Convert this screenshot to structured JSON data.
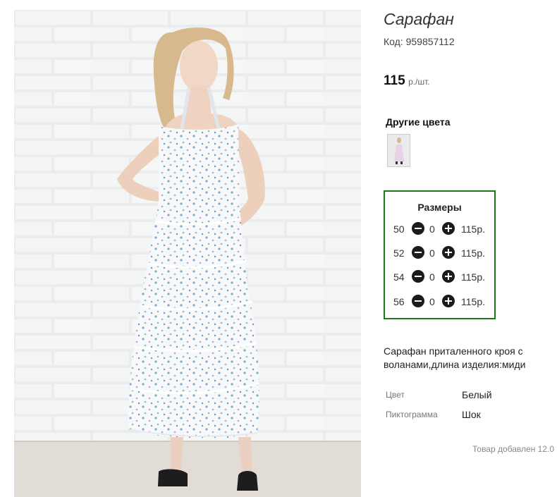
{
  "product": {
    "title": "Сарафан",
    "code_label": "Код:",
    "code": "959857112",
    "price": "115",
    "price_unit": "р./шт."
  },
  "other_colors": {
    "heading": "Другие цвета"
  },
  "sizes": {
    "heading": "Размеры",
    "rows": [
      {
        "size": "50",
        "qty": "0",
        "price": "115р."
      },
      {
        "size": "52",
        "qty": "0",
        "price": "115р."
      },
      {
        "size": "54",
        "qty": "0",
        "price": "115р."
      },
      {
        "size": "56",
        "qty": "0",
        "price": "115р."
      }
    ],
    "border_color": "#1a7a1a"
  },
  "description": "Сарафан приталенного кроя с воланами,длина изделия:миди",
  "properties": [
    {
      "label": "Цвет",
      "value": "Белый"
    },
    {
      "label": "Пиктограмма",
      "value": "Шок"
    }
  ],
  "added_text": "Товар добавлен 12.0",
  "icons": {
    "minus": "minus-circle-icon",
    "plus": "plus-circle-icon"
  }
}
